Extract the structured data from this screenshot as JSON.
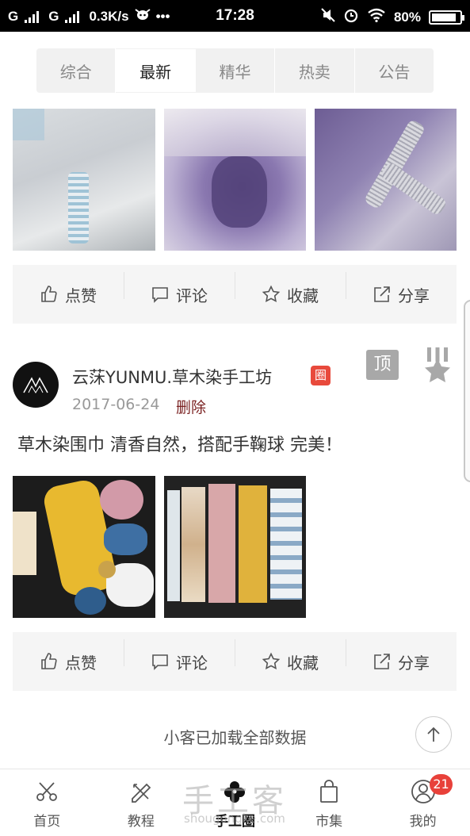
{
  "status_bar": {
    "carrier1": "G",
    "carrier2": "G",
    "speed": "0.3K/s",
    "more": "•••",
    "time": "17:28",
    "battery": "80%"
  },
  "tabs": [
    {
      "label": "综合",
      "active": false
    },
    {
      "label": "最新",
      "active": true
    },
    {
      "label": "精华",
      "active": false
    },
    {
      "label": "热卖",
      "active": false
    },
    {
      "label": "公告",
      "active": false
    }
  ],
  "actions": {
    "like": "点赞",
    "comment": "评论",
    "favorite": "收藏",
    "share": "分享"
  },
  "post": {
    "author": "云莯YUNMU.草木染手工坊",
    "circle_badge": "圈",
    "date": "2017-06-24",
    "delete_label": "删除",
    "pin_badge": "顶",
    "text": "草木染围巾 清香自然，搭配手鞠球 完美！"
  },
  "footer": {
    "loaded_text": "小客已加载全部数据"
  },
  "watermark": {
    "brand": "手工客",
    "domain": "shougongke.com"
  },
  "nav": [
    {
      "label": "首页",
      "icon": "scissors-icon"
    },
    {
      "label": "教程",
      "icon": "ruler-pencil-icon"
    },
    {
      "label": "手工圈",
      "icon": "flower-icon",
      "active": true
    },
    {
      "label": "市集",
      "icon": "shopping-bag-icon"
    },
    {
      "label": "我的",
      "icon": "user-icon",
      "badge": "21"
    }
  ],
  "colors": {
    "accent_red": "#e84a3c",
    "delete_text": "#7b2222",
    "action_bar_bg": "#f5f5f5"
  }
}
